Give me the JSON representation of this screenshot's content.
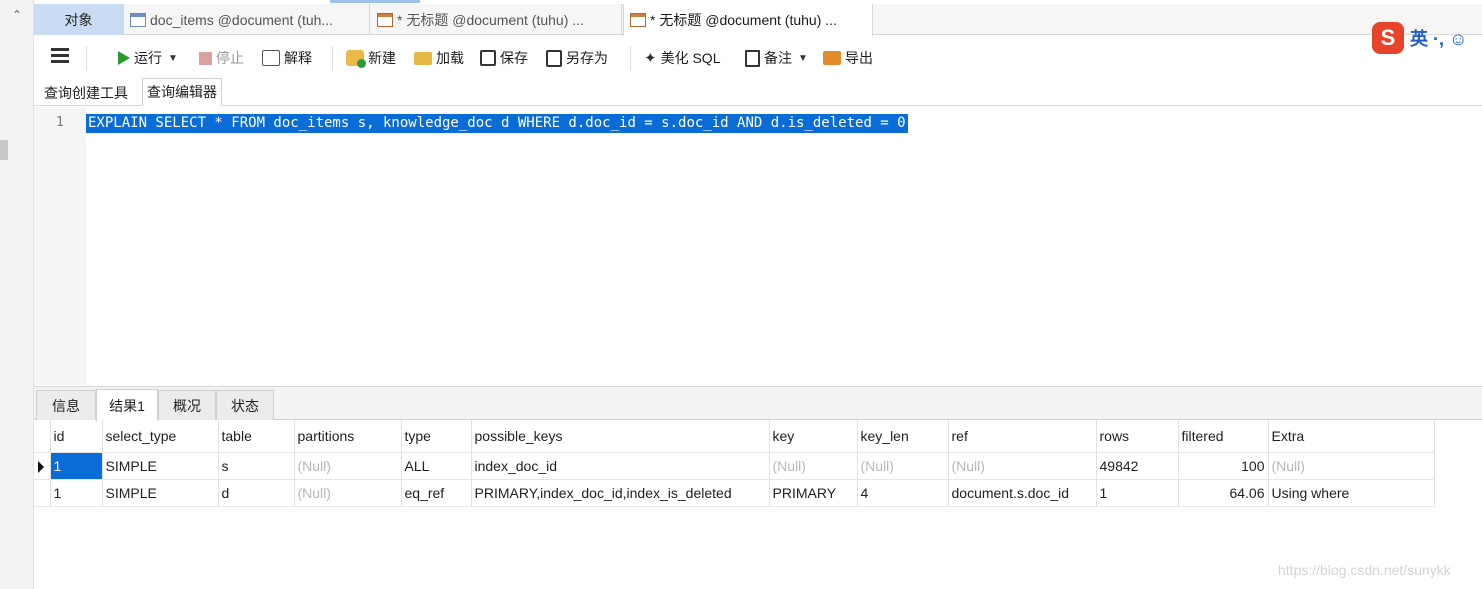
{
  "doc_tabs": [
    {
      "label": "对象",
      "icon": "none"
    },
    {
      "label": "doc_items @document (tuh...",
      "icon": "table-icon"
    },
    {
      "label": "* 无标题 @document (tuhu) ...",
      "icon": "query-icon"
    },
    {
      "label": "* 无标题 @document (tuhu) ...",
      "icon": "query-icon"
    }
  ],
  "toolbar": {
    "menu_icon": "menu-icon",
    "run": "运行",
    "stop": "停止",
    "explain": "解释",
    "new": "新建",
    "load": "加载",
    "save": "保存",
    "save_as": "另存为",
    "beautify": "美化 SQL",
    "comment": "备注",
    "export": "导出"
  },
  "ime": {
    "logo": "S",
    "text": "英 ·, ☺"
  },
  "sub_tabs": {
    "builder": "查询创建工具",
    "editor": "查询编辑器"
  },
  "editor": {
    "line_number": "1",
    "sql": "EXPLAIN SELECT * FROM doc_items s, knowledge_doc d WHERE d.doc_id = s.doc_id AND d.is_deleted = 0"
  },
  "result_tabs": {
    "info": "信息",
    "result1": "结果1",
    "overview": "概况",
    "status": "状态"
  },
  "grid": {
    "columns": [
      "id",
      "select_type",
      "table",
      "partitions",
      "type",
      "possible_keys",
      "key",
      "key_len",
      "ref",
      "rows",
      "filtered",
      "Extra"
    ],
    "rows": [
      [
        "1",
        "SIMPLE",
        "s",
        "(Null)",
        "ALL",
        "index_doc_id",
        "(Null)",
        "(Null)",
        "(Null)",
        "49842",
        "100",
        "(Null)"
      ],
      [
        "1",
        "SIMPLE",
        "d",
        "(Null)",
        "eq_ref",
        "PRIMARY,index_doc_id,index_is_deleted",
        "PRIMARY",
        "4",
        "document.s.doc_id",
        "1",
        "64.06",
        "Using where"
      ]
    ]
  },
  "watermark": "https://blog.csdn.net/sunykk",
  "colors": {
    "selection": "#0a6cd6",
    "active_tab": "#c9dcf3",
    "null_text": "#b8b8b8"
  }
}
